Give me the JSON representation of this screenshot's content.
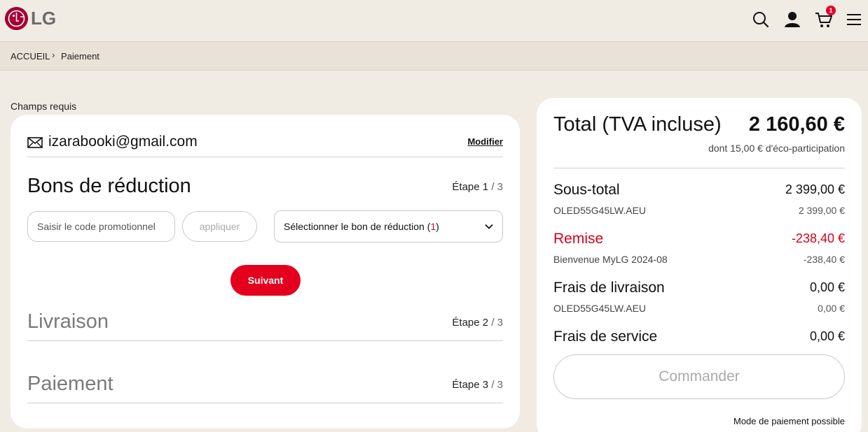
{
  "header": {
    "logo_text": "LG",
    "cart_count": "1",
    "icons": [
      "search-icon",
      "user-icon",
      "cart-icon",
      "menu-icon"
    ]
  },
  "breadcrumb": {
    "home": "ACCUEIL",
    "current": "Paiement"
  },
  "form": {
    "required_note": "Champs requis",
    "email": "izarabooki@gmail.com",
    "modify_label": "Modifier",
    "steps": [
      {
        "title": "Bons de réduction",
        "step_word": "Étape",
        "number": "1",
        "total": "3"
      },
      {
        "title": "Livraison",
        "step_word": "Étape",
        "number": "2",
        "total": "3"
      },
      {
        "title": "Paiement",
        "step_word": "Étape",
        "number": "3",
        "total": "3"
      }
    ],
    "promo_placeholder": "Saisir le code promotionnel",
    "apply_label": "appliquer",
    "voucher_select_label": "Sélectionner le bon de réduction (",
    "voucher_count": "1",
    "voucher_close": ")",
    "next_label": "Suivant"
  },
  "summary": {
    "total_label": "Total (TVA incluse)",
    "total_value": "2 160,60 €",
    "eco_note": "dont 15,00 € d'éco-participation",
    "lines": [
      {
        "label": "Sous-total",
        "value": "2 399,00 €",
        "sub_label": "OLED55G45LW.AEU",
        "sub_value": "2 399,00 €"
      },
      {
        "label": "Remise",
        "value": "-238,40 €",
        "sub_label": "Bienvenue MyLG 2024-08",
        "sub_value": "-238,40 €"
      },
      {
        "label": "Frais de livraison",
        "value": "0,00 €",
        "sub_label": "OLED55G45LW.AEU",
        "sub_value": "0,00 €"
      },
      {
        "label": "Frais de service",
        "value": "0,00 €"
      }
    ],
    "order_label": "Commander",
    "payment_mode_label": "Mode de paiement possible"
  },
  "colors": {
    "background": "#f0ece4",
    "brand_red": "#a50034",
    "accent_red": "#e4001c",
    "discount_red": "#d0021b"
  }
}
